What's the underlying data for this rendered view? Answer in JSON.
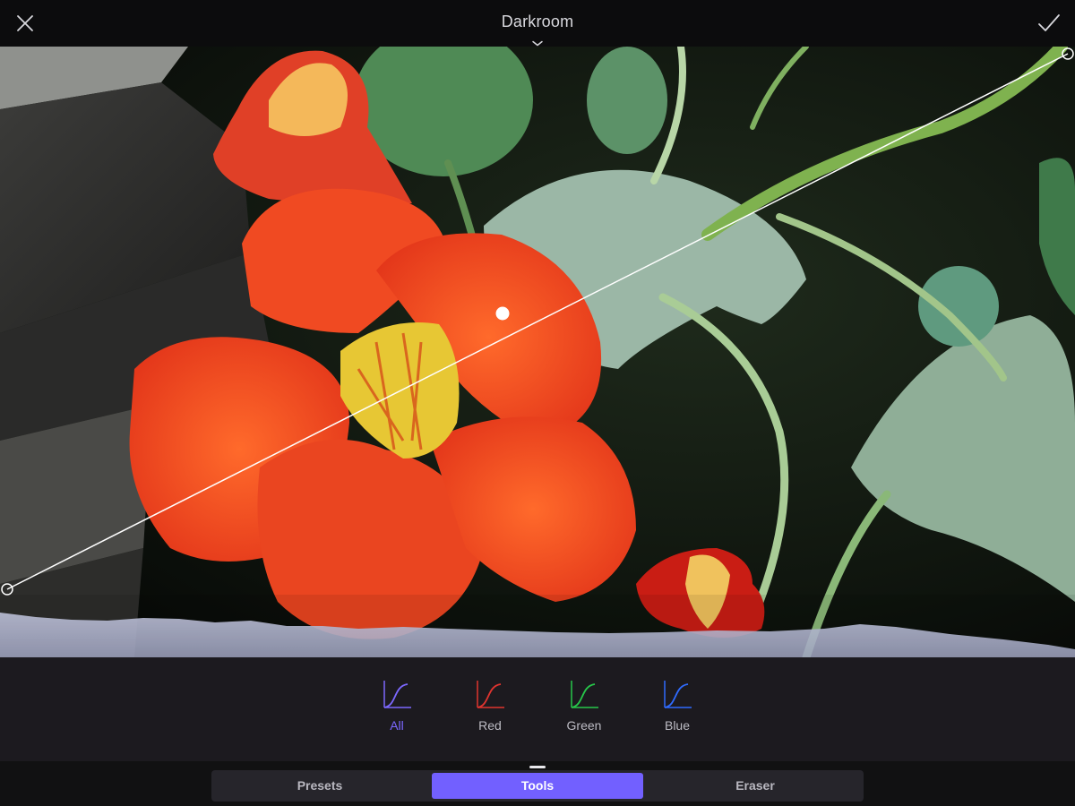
{
  "header": {
    "title": "Darkroom",
    "close_icon": "close-icon",
    "confirm_icon": "checkmark-icon",
    "title_icon": "chevron-down-icon"
  },
  "canvas": {
    "subject": "photo",
    "curve_icon": "tone-curve",
    "histogram": "histogram"
  },
  "channels": {
    "active": "All",
    "items": [
      {
        "label": "All",
        "color": "#7c68ff",
        "icon": "curve-icon"
      },
      {
        "label": "Red",
        "color": "#e0342f",
        "icon": "curve-icon"
      },
      {
        "label": "Green",
        "color": "#27c74a",
        "icon": "curve-icon"
      },
      {
        "label": "Blue",
        "color": "#2f6bff",
        "icon": "curve-icon"
      }
    ]
  },
  "tabs": {
    "active": "Tools",
    "items": [
      {
        "label": "Presets"
      },
      {
        "label": "Tools"
      },
      {
        "label": "Eraser"
      }
    ]
  },
  "colors": {
    "accent": "#7260ff",
    "text": "#d9d9de"
  }
}
